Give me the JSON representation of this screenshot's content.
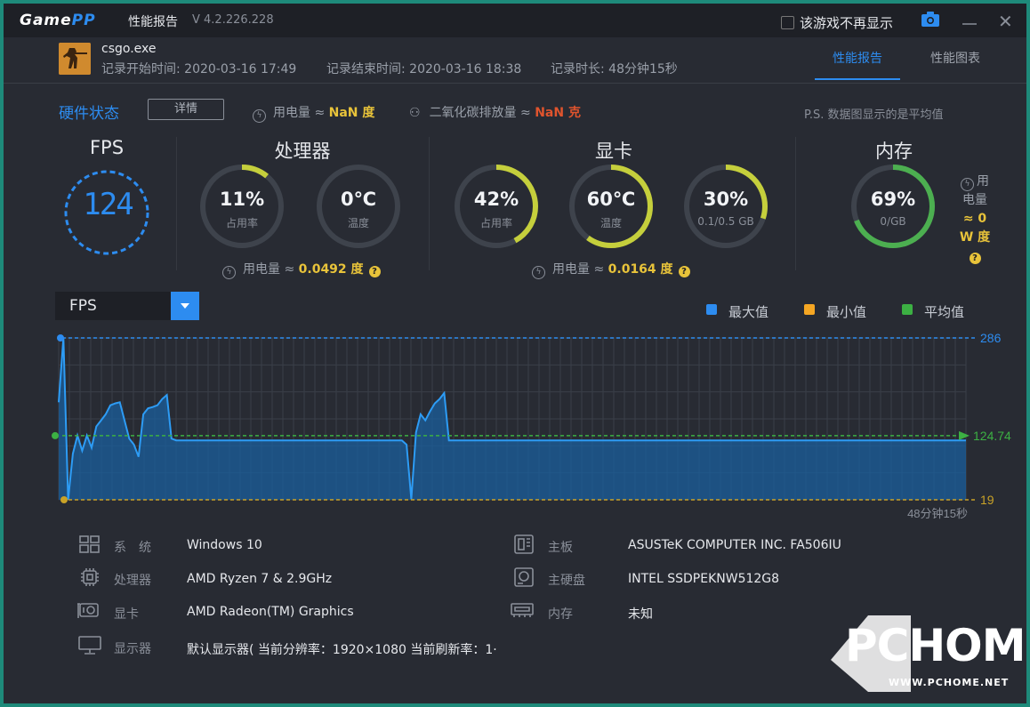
{
  "titlebar": {
    "logo_part1": "Game",
    "logo_part2": "PP",
    "app_title": "性能报告",
    "version": "V 4.2.226.228",
    "dont_show": "该游戏不再显示"
  },
  "session": {
    "game": "csgo.exe",
    "start": "记录开始时间: 2020-03-16 17:49",
    "end": "记录结束时间: 2020-03-16 18:38",
    "duration": "记录时长: 48分钟15秒"
  },
  "tabs": [
    {
      "label": "性能报告",
      "active": true
    },
    {
      "label": "性能图表",
      "active": false
    }
  ],
  "hardware": {
    "title": "硬件状态",
    "detail_button": "详情",
    "power_label": "用电量 ≈",
    "power_value": "NaN 度",
    "co2_label": "二氧化碳排放量 ≈",
    "co2_value": "NaN 克",
    "note": "P.S. 数据图显示的是平均值"
  },
  "fps": {
    "title": "FPS",
    "value": "124"
  },
  "cpu": {
    "title": "处理器",
    "usage": {
      "value": "11%",
      "label": "占用率",
      "fraction": 0.11
    },
    "temp": {
      "value": "0℃",
      "label": "温度",
      "fraction": 0.0
    },
    "power_label": "用电量 ≈",
    "power_value": "0.0492 度"
  },
  "gpu": {
    "title": "显卡",
    "usage": {
      "value": "42%",
      "label": "占用率",
      "fraction": 0.42
    },
    "temp": {
      "value": "60℃",
      "label": "温度",
      "fraction": 0.6
    },
    "mem": {
      "value": "30%",
      "label": "0.1/0.5 GB",
      "fraction": 0.3
    },
    "power_label": "用电量 ≈",
    "power_value": "0.0164 度"
  },
  "memory": {
    "title": "内存",
    "usage": {
      "value": "69%",
      "label": "0/GB",
      "fraction": 0.69
    },
    "power_line1": "用",
    "power_line2": "电量",
    "power_line3": "≈ 0",
    "power_line4": "W 度"
  },
  "chart": {
    "select_value": "FPS",
    "legend": [
      {
        "label": "最大值",
        "color": "#2d8cf0"
      },
      {
        "label": "最小值",
        "color": "#f5a623"
      },
      {
        "label": "平均值",
        "color": "#3cb043"
      }
    ],
    "max_label": "286",
    "avg_label": "124.74",
    "min_label": "19",
    "x_end_label": "48分钟15秒"
  },
  "chart_data": {
    "type": "area",
    "title": "",
    "xlabel": "",
    "ylabel": "",
    "ylim": [
      19,
      286
    ],
    "max": 286,
    "min": 19,
    "avg": 124.74,
    "xlim_label": "48分钟15秒",
    "series": [
      {
        "values": [
          180,
          286,
          19,
          95,
          125,
          100,
          125,
          105,
          140,
          150,
          160,
          175,
          178,
          180,
          150,
          120,
          110,
          90,
          160,
          170,
          172,
          175,
          185,
          192,
          120,
          117,
          117,
          117,
          117,
          117,
          117,
          117,
          117,
          117,
          117,
          117,
          117,
          117,
          117,
          117,
          117,
          117,
          117,
          117,
          117,
          117,
          117,
          117,
          117,
          117,
          117,
          117,
          117,
          117,
          117,
          117,
          117,
          117,
          117,
          117,
          117,
          117,
          117,
          117,
          117,
          117,
          117,
          117,
          117,
          117,
          117,
          117,
          117,
          117,
          110,
          20,
          130,
          160,
          150,
          165,
          178,
          185,
          195,
          117,
          117,
          117,
          117,
          117,
          117,
          117,
          117,
          117,
          117,
          117,
          117,
          117,
          117,
          117,
          117,
          117,
          117,
          117,
          117,
          117,
          117,
          117,
          117,
          117,
          117,
          117,
          117,
          117,
          117,
          117,
          117,
          117,
          117,
          117,
          117,
          117,
          117,
          117,
          117,
          117,
          117,
          117,
          117,
          117,
          117,
          117,
          117,
          117,
          117,
          117,
          117,
          117,
          117,
          117,
          117,
          117,
          117,
          117,
          117,
          117,
          117,
          117,
          117,
          117,
          117,
          117,
          117,
          117,
          117,
          117,
          117,
          117,
          117,
          117,
          117,
          117,
          117,
          117,
          117,
          117,
          117,
          117,
          117,
          117,
          117,
          117,
          117,
          117,
          117,
          117,
          117,
          117,
          117,
          117,
          117,
          117,
          117,
          117,
          117,
          117,
          117,
          117,
          117,
          117,
          117,
          117,
          117,
          117,
          117,
          117
        ]
      }
    ]
  },
  "system": {
    "os_label": "系　统",
    "os": "Windows 10",
    "cpu_label": "处理器",
    "cpu": "AMD Ryzen 7 & 2.9GHz",
    "gpu_label": "显卡",
    "gpu": "AMD Radeon(TM) Graphics",
    "display_label": "显示器",
    "display": "默认显示器( 当前分辨率：1920×1080 当前刷新率：1·",
    "board_label": "主板",
    "board": "ASUSTeK COMPUTER INC. FA506IU",
    "disk_label": "主硬盘",
    "disk": "INTEL SSDPEKNW512G8",
    "ram_label": "内存",
    "ram": "未知"
  },
  "watermark": {
    "text": "PCHOME",
    "url": "WWW.PCHOME.NET"
  },
  "colors": {
    "accent": "#2d8cf0",
    "yellow": "#e8c33a",
    "green": "#3cb043",
    "orange": "#f5a623",
    "red": "#e0542d"
  }
}
